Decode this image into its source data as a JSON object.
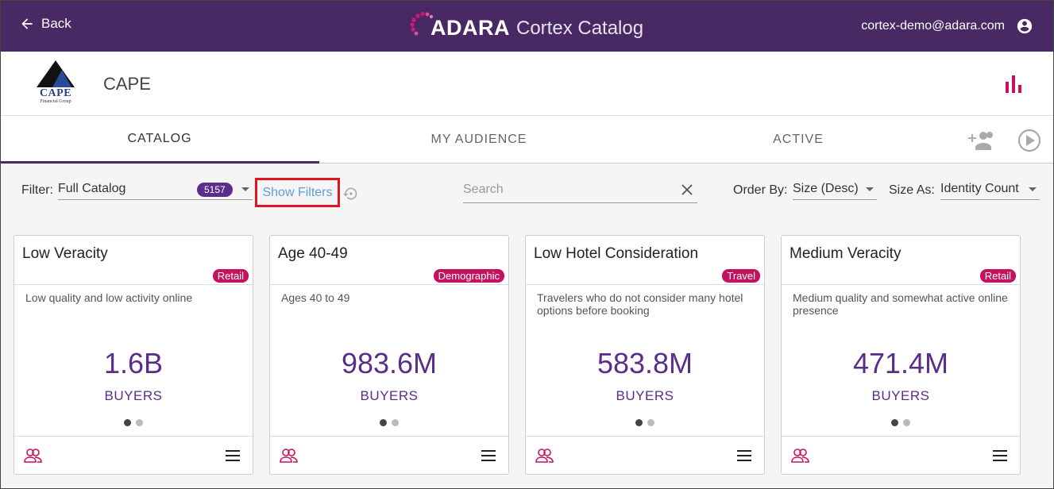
{
  "topbar": {
    "back_label": "Back",
    "brand_name": "ADARA",
    "product_name": "Cortex Catalog",
    "user_email": "cortex-demo@adara.com"
  },
  "header": {
    "logo_name": "CAPE",
    "logo_sub": "Financial Group",
    "company": "CAPE"
  },
  "tabs": [
    {
      "label": "CATALOG",
      "active": true
    },
    {
      "label": "MY AUDIENCE",
      "active": false
    },
    {
      "label": "ACTIVE",
      "active": false
    }
  ],
  "filter": {
    "label": "Filter:",
    "value": "Full Catalog",
    "count": "5157",
    "show_filters": "Show Filters",
    "search_placeholder": "Search",
    "order_label": "Order By:",
    "order_value": "Size (Desc)",
    "size_label": "Size As:",
    "size_value": "Identity Count"
  },
  "cards": [
    {
      "title": "Low Veracity",
      "tag": "Retail",
      "desc": "Low quality and low activity online",
      "value": "1.6B",
      "unit": "BUYERS"
    },
    {
      "title": "Age 40-49",
      "tag": "Demographic",
      "desc": "Ages 40 to 49",
      "value": "983.6M",
      "unit": "BUYERS"
    },
    {
      "title": "Low Hotel Consideration",
      "tag": "Travel",
      "desc": "Travelers who do not consider many hotel options before booking",
      "value": "583.8M",
      "unit": "BUYERS"
    },
    {
      "title": "Medium Veracity",
      "tag": "Retail",
      "desc": "Medium quality and somewhat active online presence",
      "value": "471.4M",
      "unit": "BUYERS"
    }
  ],
  "colors": {
    "topbar": "#482964",
    "accent": "#5b2d8a",
    "tag": "#c4125f",
    "highlight": "#e0141e",
    "link": "#5b9fe0"
  }
}
